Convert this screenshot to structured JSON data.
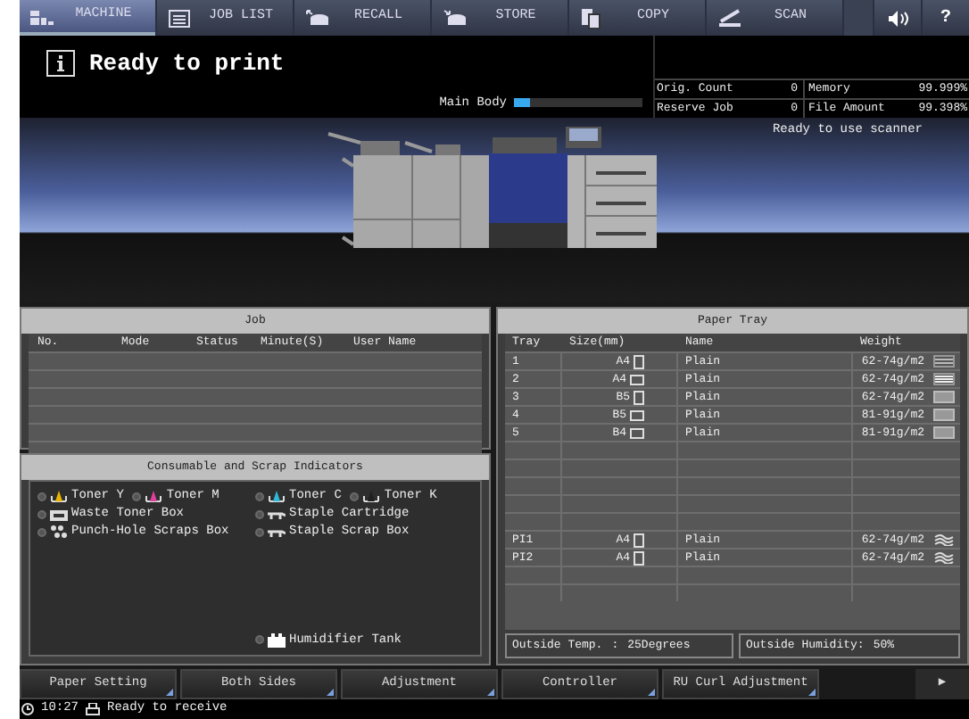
{
  "top_tabs": [
    {
      "label": "MACHINE",
      "selected": true
    },
    {
      "label": "JOB LIST",
      "selected": false
    },
    {
      "label": "RECALL",
      "selected": false
    },
    {
      "label": "STORE",
      "selected": false
    },
    {
      "label": "COPY",
      "selected": false
    },
    {
      "label": "SCAN",
      "selected": false
    }
  ],
  "help_label": "?",
  "status": {
    "message": "Ready to print"
  },
  "main_body": {
    "label": "Main Body",
    "level": 0.12
  },
  "counters": [
    {
      "label": "Orig. Count",
      "value": "0",
      "label_2": "Memory",
      "value_2": "99.999%"
    },
    {
      "label": "Reserve Job",
      "value": "0",
      "label_2": "File Amount",
      "value_2": "99.398%"
    }
  ],
  "scanner_status": "Ready to use scanner",
  "job": {
    "title": "Job",
    "columns": [
      "No.",
      "Mode",
      "Status",
      "Minute(S)",
      "User Name"
    ]
  },
  "consumables": {
    "title": "Consumable and Scrap Indicators",
    "columns": [
      [
        [
          {
            "label": "Toner Y",
            "kind": "toner",
            "color": "#e8b400"
          },
          {
            "label": "Toner M",
            "kind": "toner",
            "color": "#e0409a"
          }
        ],
        [
          {
            "label": "Waste Toner Box",
            "kind": "waste"
          }
        ],
        [
          {
            "label": "Punch-Hole Scraps Box",
            "kind": "punch"
          }
        ]
      ],
      [
        [
          {
            "label": "Toner C",
            "kind": "toner",
            "color": "#30b8d8"
          },
          {
            "label": "Toner K",
            "kind": "toner",
            "color": "#202020"
          }
        ],
        [
          {
            "label": "Staple Cartridge",
            "kind": "staple"
          }
        ],
        [
          {
            "label": "Staple Scrap Box",
            "kind": "staple"
          }
        ]
      ]
    ],
    "bottom_item": {
      "label": "Humidifier Tank",
      "kind": "tank"
    }
  },
  "paper_tray": {
    "title": "Paper Tray",
    "columns": [
      "Tray",
      "Size(mm)",
      "Name",
      "Weight"
    ],
    "main_trays": [
      {
        "tray": "1",
        "size": "A4",
        "landscape": false,
        "name": "Plain",
        "weight": "62-74g/m2",
        "kind": "lines"
      },
      {
        "tray": "2",
        "size": "A4",
        "landscape": true,
        "name": "Plain",
        "weight": "62-74g/m2",
        "kind": "dense"
      },
      {
        "tray": "3",
        "size": "B5",
        "landscape": false,
        "name": "Plain",
        "weight": "62-74g/m2",
        "kind": "solid"
      },
      {
        "tray": "4",
        "size": "B5",
        "landscape": true,
        "name": "Plain",
        "weight": "81-91g/m2",
        "kind": "solid"
      },
      {
        "tray": "5",
        "size": "B4",
        "landscape": true,
        "name": "Plain",
        "weight": "81-91g/m2",
        "kind": "solid"
      }
    ],
    "pi_trays": [
      {
        "tray": "PI1",
        "size": "A4",
        "landscape": false,
        "name": "Plain",
        "weight": "62-74g/m2",
        "kind": "wavy"
      },
      {
        "tray": "PI2",
        "size": "A4",
        "landscape": false,
        "name": "Plain",
        "weight": "62-74g/m2",
        "kind": "wavy"
      }
    ],
    "temp_label": "Outside Temp.",
    "temp_sep": ":",
    "temp_value": "25Degrees",
    "humidity_label": "Outside Humidity:",
    "humidity_value": "50%"
  },
  "function_buttons": [
    "Paper Setting",
    "Both Sides",
    "Adjustment",
    "Controller",
    "RU Curl Adjustment"
  ],
  "next_label": "▶",
  "status_bar": {
    "time": "10:27",
    "message": "Ready to receive"
  }
}
